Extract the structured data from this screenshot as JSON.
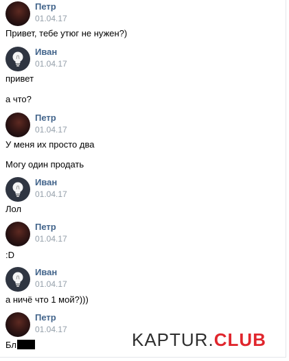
{
  "messages": [
    {
      "author": "Петр",
      "date": "01.04.17",
      "lines": [
        "Привет, тебе утюг не нужен?)"
      ]
    },
    {
      "author": "Иван",
      "date": "01.04.17",
      "lines": [
        "привет",
        "а что?"
      ]
    },
    {
      "author": "Петр",
      "date": "01.04.17",
      "lines": [
        "У меня их просто два",
        "Могу один продать"
      ]
    },
    {
      "author": "Иван",
      "date": "01.04.17",
      "lines": [
        "Лол"
      ]
    },
    {
      "author": "Петр",
      "date": "01.04.17",
      "lines": [
        ":D"
      ]
    },
    {
      "author": "Иван",
      "date": "01.04.17",
      "lines": [
        "а ничё что 1 мой?)))"
      ]
    },
    {
      "author": "Петр",
      "date": "01.04.17",
      "lines": [
        "Бл"
      ]
    }
  ],
  "watermark": {
    "part1": "KAPTUR.",
    "part2": "CLUB"
  },
  "colors": {
    "author": "#42648b",
    "date": "#939ea9",
    "accent": "#e0262d"
  }
}
